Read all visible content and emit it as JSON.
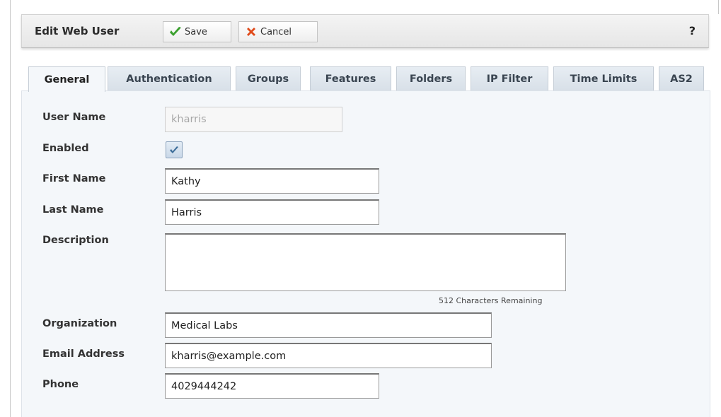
{
  "toolbar": {
    "title": "Edit Web User",
    "save_label": "Save",
    "cancel_label": "Cancel",
    "help_label": "?"
  },
  "tabs": [
    {
      "label": "General",
      "active": true
    },
    {
      "label": "Authentication"
    },
    {
      "label": "Groups"
    },
    {
      "label": "Features"
    },
    {
      "label": "Folders"
    },
    {
      "label": "IP Filter"
    },
    {
      "label": "Time Limits"
    },
    {
      "label": "AS2"
    }
  ],
  "form": {
    "username_label": "User Name",
    "username_value": "kharris",
    "enabled_label": "Enabled",
    "enabled": true,
    "firstname_label": "First Name",
    "firstname_value": "Kathy",
    "lastname_label": "Last Name",
    "lastname_value": "Harris",
    "description_label": "Description",
    "description_value": "",
    "description_counter": "512 Characters Remaining",
    "organization_label": "Organization",
    "organization_value": "Medical Labs",
    "email_label": "Email Address",
    "email_value": "kharris@example.com",
    "phone_label": "Phone",
    "phone_value": "4029444242"
  },
  "colors": {
    "save_check": "#3aa02e",
    "cancel_x": "#e04a1a",
    "panel_bg": "#f4f7fa"
  }
}
